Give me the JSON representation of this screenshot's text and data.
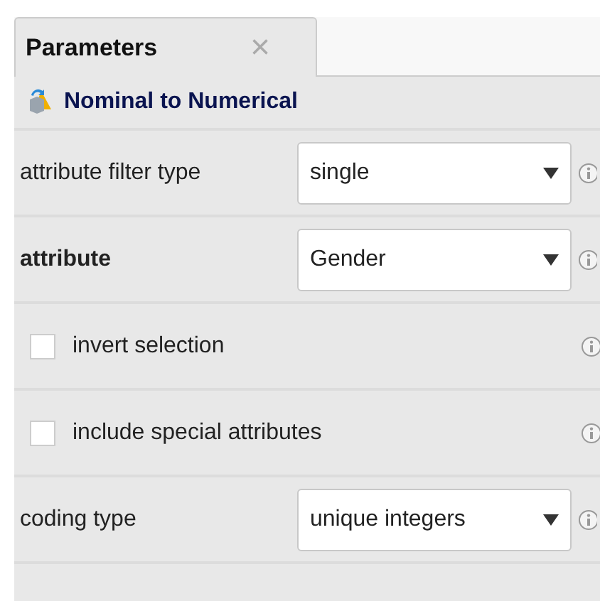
{
  "tab": {
    "label": "Parameters",
    "close": "×",
    "selected": true
  },
  "operator": {
    "title": "Nominal to Numerical"
  },
  "parameters": [
    {
      "kind": "select",
      "label": "attribute filter type",
      "bold": false,
      "value": "single"
    },
    {
      "kind": "select",
      "label": "attribute",
      "bold": true,
      "value": "Gender"
    },
    {
      "kind": "checkbox",
      "label": "invert selection",
      "checked": false
    },
    {
      "kind": "checkbox",
      "label": "include special attributes",
      "checked": false
    },
    {
      "kind": "select",
      "label": "coding type",
      "bold": false,
      "value": "unique integers"
    }
  ]
}
